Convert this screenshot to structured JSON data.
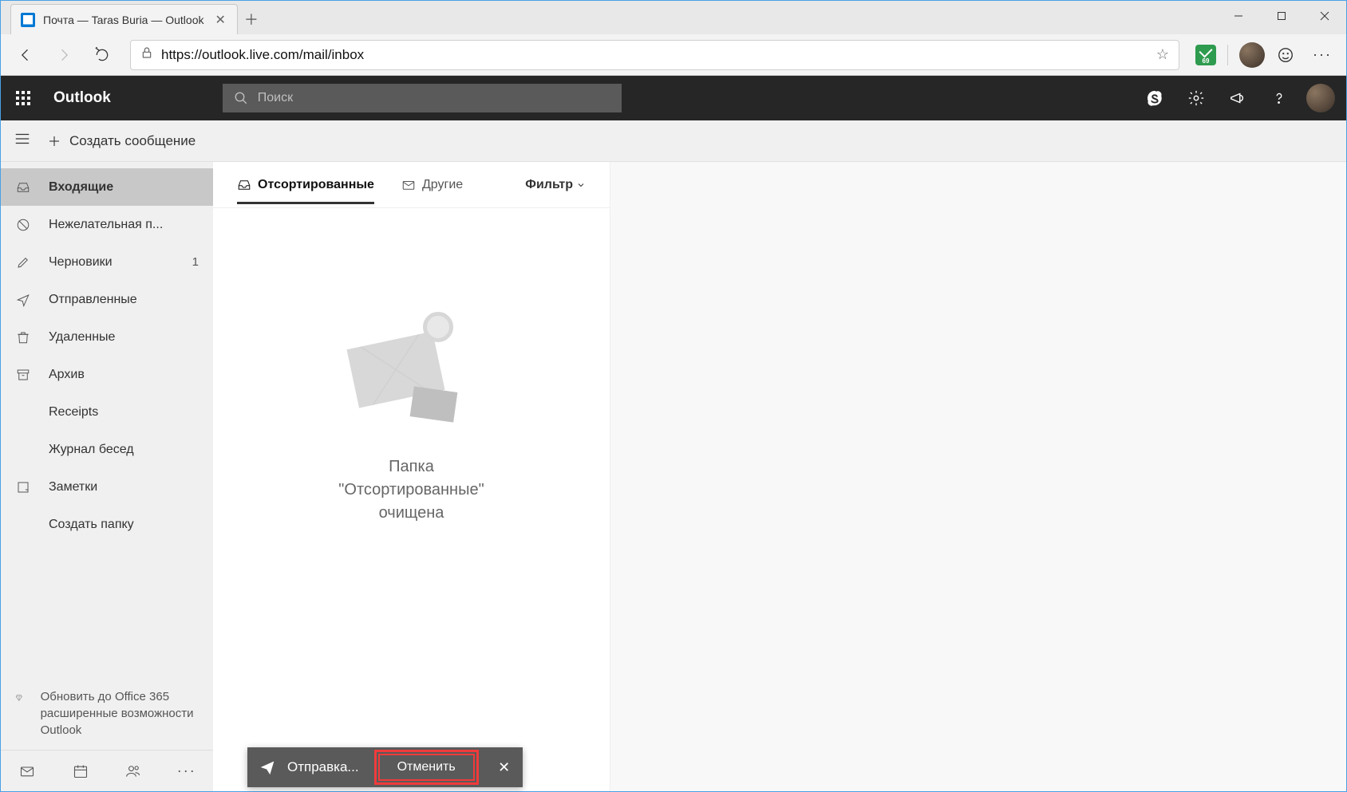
{
  "browser": {
    "tab_title": "Почта — Taras Buria — Outlook",
    "url": "https://outlook.live.com/mail/inbox",
    "ext_badge": "69"
  },
  "suite": {
    "brand": "Outlook",
    "search_placeholder": "Поиск"
  },
  "cmdbar": {
    "compose": "Создать сообщение"
  },
  "folders": [
    {
      "key": "inbox",
      "label": "Входящие",
      "icon": "inbox",
      "active": true
    },
    {
      "key": "junk",
      "label": "Нежелательная п...",
      "icon": "block"
    },
    {
      "key": "drafts",
      "label": "Черновики",
      "icon": "pencil",
      "count": "1"
    },
    {
      "key": "sent",
      "label": "Отправленные",
      "icon": "send"
    },
    {
      "key": "deleted",
      "label": "Удаленные",
      "icon": "trash"
    },
    {
      "key": "archive",
      "label": "Архив",
      "icon": "archive"
    },
    {
      "key": "receipts",
      "label": "Receipts",
      "icon": "",
      "indent": true
    },
    {
      "key": "convlog",
      "label": "Журнал бесед",
      "icon": "",
      "indent": true
    },
    {
      "key": "notes",
      "label": "Заметки",
      "icon": "note"
    },
    {
      "key": "newfolder",
      "label": "Создать папку",
      "icon": "",
      "indent": true
    }
  ],
  "upgrade": "Обновить до Office 365 расширенные возможности Outlook",
  "pivots": {
    "focused": "Отсортированные",
    "other": "Другие",
    "filter": "Фильтр"
  },
  "empty_message": "Папка\n\"Отсортированные\"\nочищена",
  "toast": {
    "text": "Отправка...",
    "cancel": "Отменить"
  }
}
